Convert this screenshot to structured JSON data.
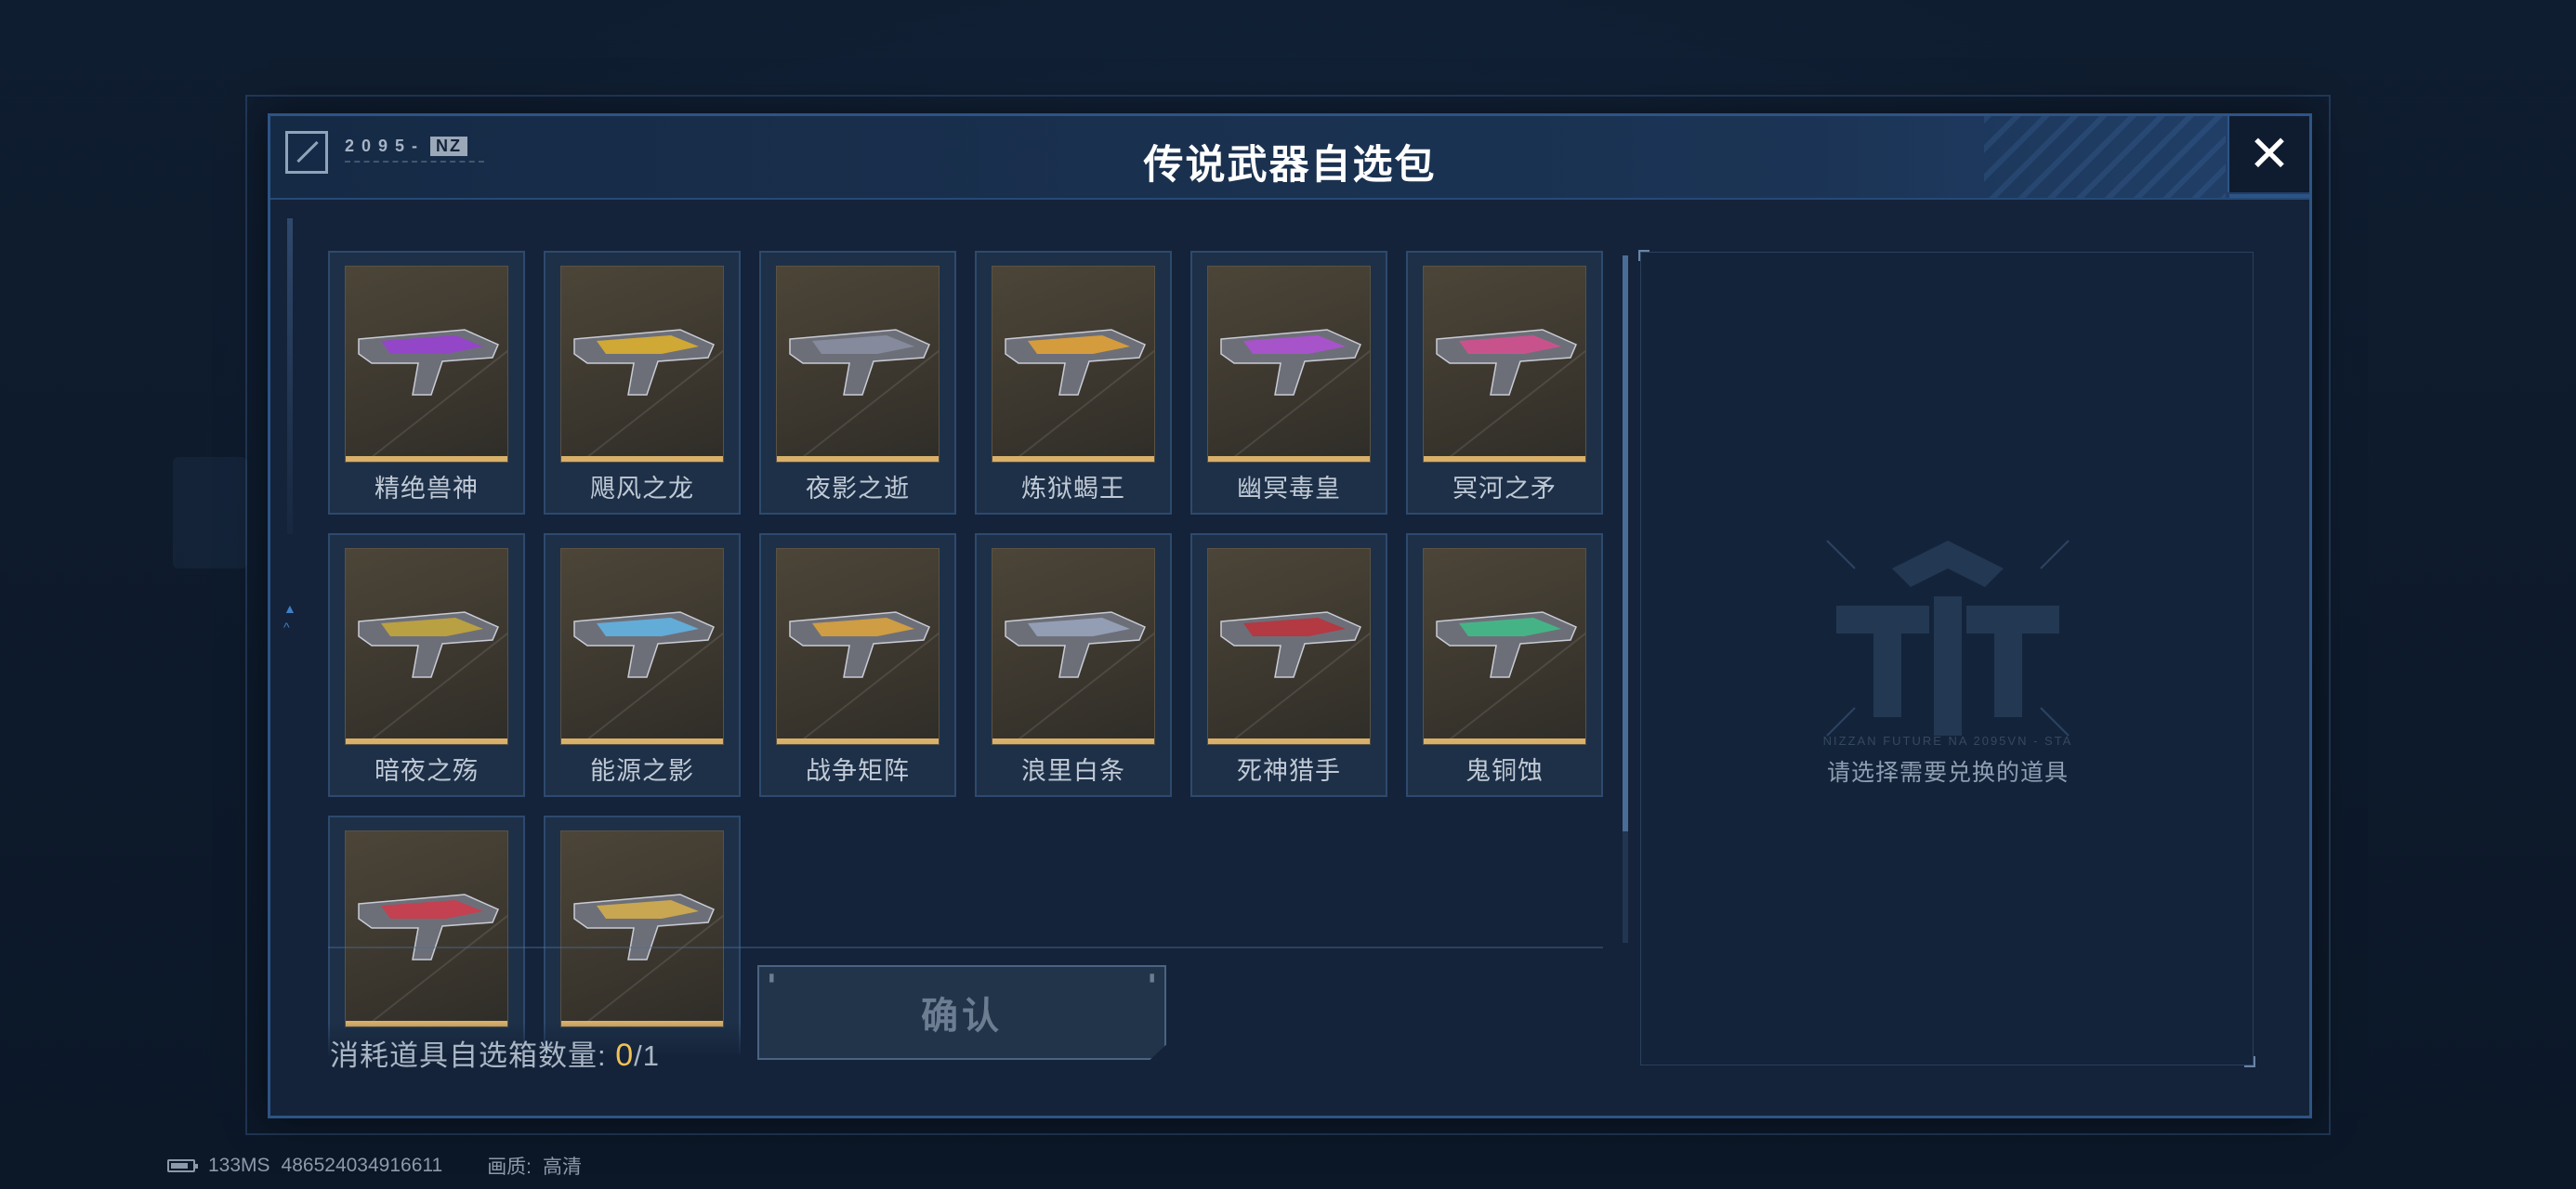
{
  "modal": {
    "title": "传说武器自选包",
    "logo_text": "2095-",
    "logo_badge": "NZ",
    "close_label": "✕"
  },
  "items": [
    {
      "label": "精绝兽神",
      "accent": "#9b3fd6"
    },
    {
      "label": "飓风之龙",
      "accent": "#e0b32a"
    },
    {
      "label": "夜影之逝",
      "accent": "#8a8fa3"
    },
    {
      "label": "炼狱蝎王",
      "accent": "#e8a532"
    },
    {
      "label": "幽冥毒皇",
      "accent": "#b24fd8"
    },
    {
      "label": "冥河之矛",
      "accent": "#d84f8f"
    },
    {
      "label": "暗夜之殇",
      "accent": "#c7a93a"
    },
    {
      "label": "能源之影",
      "accent": "#62b7e8"
    },
    {
      "label": "战争矩阵",
      "accent": "#e0a63a"
    },
    {
      "label": "浪里白条",
      "accent": "#9aa7c0"
    },
    {
      "label": "死神猎手",
      "accent": "#c0303a"
    },
    {
      "label": "鬼铜蚀",
      "accent": "#3fc08a"
    },
    {
      "label": "",
      "accent": "#d23a4a"
    },
    {
      "label": "",
      "accent": "#d9b04a"
    }
  ],
  "footer": {
    "consume_prefix": "消耗道具自选箱数量:",
    "consume_current": "0",
    "consume_total": "/1",
    "confirm_label": "确认"
  },
  "detail": {
    "empty_hint": "请选择需要兑换的道具",
    "emblem_caption": "NIZZAN FUTURE NA 2095VN - STA"
  },
  "status": {
    "ping": "133MS",
    "id": "486524034916611",
    "quality_label": "画质:",
    "quality_value": "高清"
  }
}
